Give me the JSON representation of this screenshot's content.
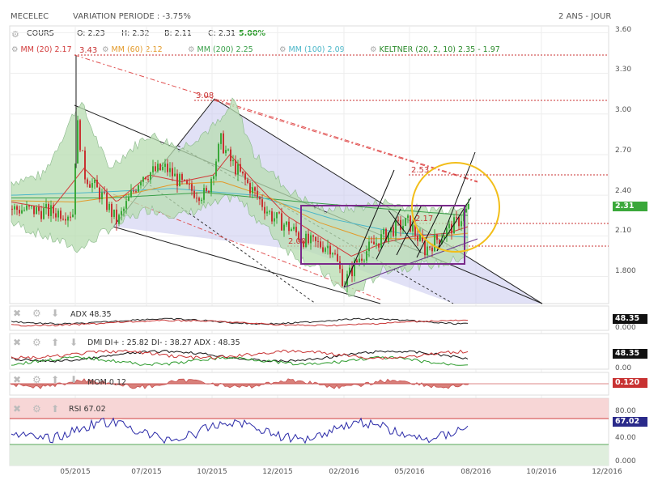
{
  "header": {
    "ticker": "MECELEC",
    "variation": "VARIATION PERIODE : -3.75%",
    "period": "2 ANS - JOUR"
  },
  "ohlc": {
    "label": "COURS",
    "open": "O: 2.23",
    "high": "H: 2.32",
    "low": "B: 2.11",
    "close": "C: 2.31",
    "change": "5.00%"
  },
  "legend": [
    {
      "text": "MM (20) 2.17",
      "color": "#d23a3a"
    },
    {
      "text": "MM (60) 2.12",
      "color": "#e39a2a"
    },
    {
      "text": "MM (200) 2.25",
      "color": "#3aa04a"
    },
    {
      "text": "MM (100) 2.09",
      "color": "#4ab6c8"
    },
    {
      "text": "KELTNER (20, 2, 10) 2.35 - 1.97",
      "color": "#2a8a2a"
    }
  ],
  "annotations": {
    "high_spike": "3.43",
    "peak": "3.08",
    "target": "2.53",
    "mid": "2.17",
    "low": "2.00"
  },
  "last_price": "2.31",
  "colors": {
    "up": "#3aa83a",
    "down": "#c83232",
    "keltner_fill": "#b7dcb0",
    "channel_fill": "#c9c9ee",
    "rect": "#7a2a8a",
    "circle": "#f2be1a"
  },
  "indicators": {
    "adx": {
      "label": "ADX 48.35",
      "badge": "48.35",
      "zero": "0.000"
    },
    "dmi": {
      "label": "DMI DI+ : 25.82 DI- : 38.27 ADX : 48.35",
      "badge": "48.35",
      "zero": "0.00"
    },
    "mom": {
      "label": "MOM 0.12",
      "badge": "0.120"
    },
    "rsi": {
      "label": "RSI 67.02",
      "badge": "67.02",
      "ticks": [
        "80.00",
        "40.00",
        "0.000"
      ]
    }
  },
  "chart_data": {
    "type": "candlestick",
    "y_ticks": [
      "3.60",
      "3.30",
      "3.00",
      "2.70",
      "2.40",
      "2.10",
      "1.800"
    ],
    "ylim": [
      1.6,
      3.65
    ],
    "x_ticks": [
      "05/2015",
      "07/2015",
      "10/2015",
      "12/2015",
      "02/2016",
      "05/2016",
      "08/2016",
      "10/2016",
      "12/2016"
    ],
    "series": [
      {
        "name": "COURS",
        "anchors": [
          [
            0,
            2.3
          ],
          [
            40,
            2.28
          ],
          [
            75,
            2.27
          ],
          [
            80,
            2.95
          ],
          [
            90,
            2.55
          ],
          [
            110,
            2.4
          ],
          [
            130,
            2.2
          ],
          [
            160,
            2.55
          ],
          [
            190,
            2.6
          ],
          [
            215,
            2.45
          ],
          [
            240,
            2.4
          ],
          [
            258,
            2.8
          ],
          [
            270,
            2.65
          ],
          [
            295,
            2.45
          ],
          [
            320,
            2.25
          ],
          [
            345,
            2.15
          ],
          [
            365,
            2.05
          ],
          [
            395,
            2.02
          ],
          [
            410,
            1.75
          ],
          [
            430,
            1.95
          ],
          [
            450,
            2.05
          ],
          [
            470,
            2.15
          ],
          [
            490,
            2.2
          ],
          [
            510,
            2.0
          ],
          [
            530,
            2.1
          ],
          [
            550,
            2.2
          ],
          [
            565,
            2.31
          ]
        ]
      }
    ],
    "ma20": [
      [
        0,
        2.35
      ],
      [
        50,
        2.3
      ],
      [
        90,
        2.6
      ],
      [
        130,
        2.35
      ],
      [
        170,
        2.55
      ],
      [
        210,
        2.5
      ],
      [
        250,
        2.55
      ],
      [
        270,
        2.7
      ],
      [
        300,
        2.5
      ],
      [
        340,
        2.25
      ],
      [
        380,
        2.1
      ],
      [
        420,
        1.95
      ],
      [
        460,
        2.05
      ],
      [
        500,
        2.1
      ],
      [
        540,
        2.12
      ],
      [
        565,
        2.17
      ]
    ],
    "ma60": [
      [
        0,
        2.36
      ],
      [
        80,
        2.35
      ],
      [
        140,
        2.4
      ],
      [
        200,
        2.48
      ],
      [
        260,
        2.5
      ],
      [
        320,
        2.38
      ],
      [
        380,
        2.2
      ],
      [
        440,
        2.08
      ],
      [
        500,
        2.08
      ],
      [
        565,
        2.12
      ]
    ],
    "ma200": [
      [
        0,
        2.38
      ],
      [
        120,
        2.38
      ],
      [
        240,
        2.42
      ],
      [
        360,
        2.35
      ],
      [
        460,
        2.3
      ],
      [
        565,
        2.25
      ]
    ],
    "ma100": [
      [
        0,
        2.4
      ],
      [
        100,
        2.42
      ],
      [
        200,
        2.45
      ],
      [
        300,
        2.4
      ],
      [
        400,
        2.22
      ],
      [
        480,
        2.12
      ],
      [
        565,
        2.09
      ]
    ],
    "keltner_upper": [
      [
        0,
        2.5
      ],
      [
        40,
        2.55
      ],
      [
        85,
        3.1
      ],
      [
        120,
        2.6
      ],
      [
        170,
        2.85
      ],
      [
        210,
        2.75
      ],
      [
        260,
        2.95
      ],
      [
        275,
        3.1
      ],
      [
        300,
        2.7
      ],
      [
        340,
        2.45
      ],
      [
        380,
        2.3
      ],
      [
        420,
        2.3
      ],
      [
        460,
        2.35
      ],
      [
        500,
        2.3
      ],
      [
        540,
        2.3
      ],
      [
        565,
        2.35
      ]
    ],
    "keltner_lower": [
      [
        0,
        2.2
      ],
      [
        40,
        2.1
      ],
      [
        85,
        2.0
      ],
      [
        120,
        2.15
      ],
      [
        170,
        2.3
      ],
      [
        210,
        2.25
      ],
      [
        260,
        2.35
      ],
      [
        275,
        2.4
      ],
      [
        300,
        2.25
      ],
      [
        340,
        2.0
      ],
      [
        380,
        1.85
      ],
      [
        420,
        1.65
      ],
      [
        460,
        1.85
      ],
      [
        500,
        1.88
      ],
      [
        540,
        1.9
      ],
      [
        565,
        1.97
      ]
    ]
  }
}
